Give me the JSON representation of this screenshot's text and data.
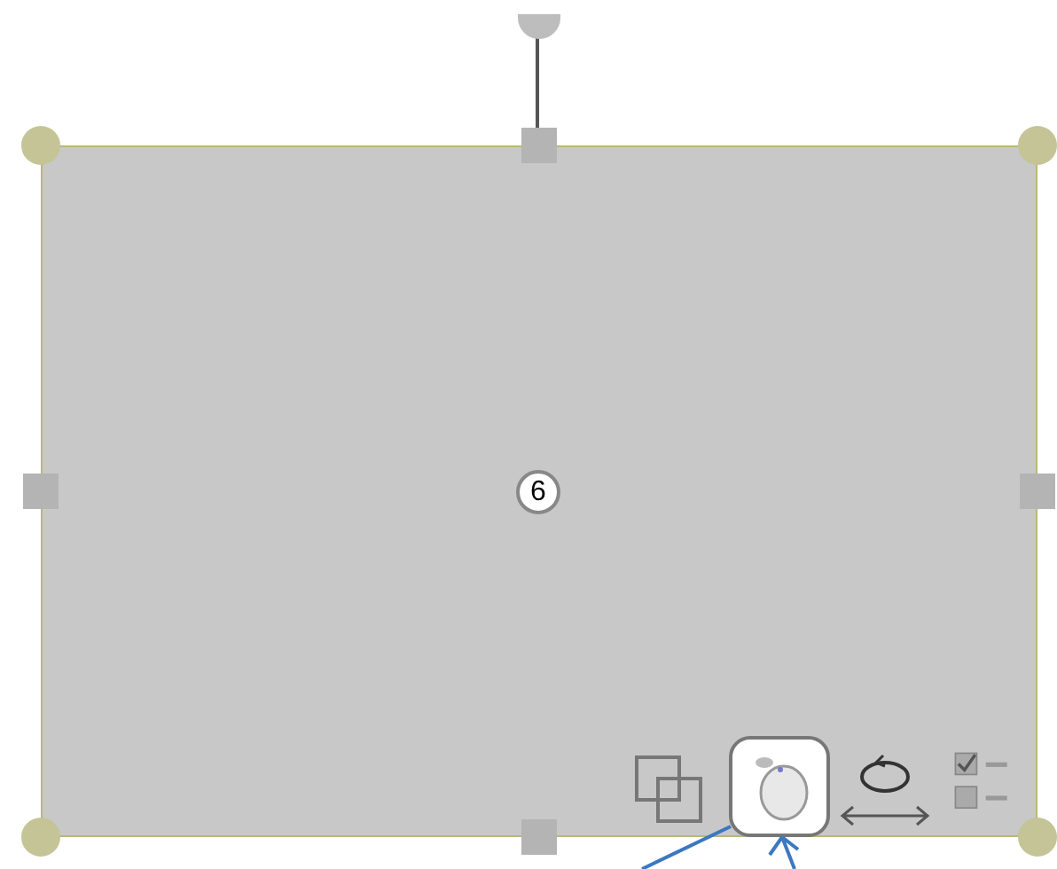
{
  "shape": {
    "badge": "6"
  },
  "toolbar": [
    {
      "kind": "arrange",
      "selected": false
    },
    {
      "kind": "mouse",
      "selected": true
    },
    {
      "kind": "rotate",
      "selected": false
    },
    {
      "kind": "checklist",
      "selected": false
    }
  ]
}
